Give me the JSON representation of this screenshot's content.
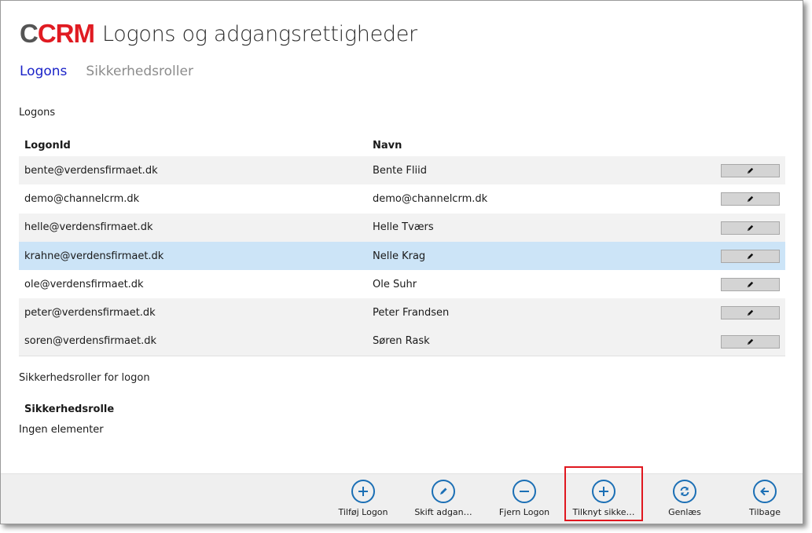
{
  "header": {
    "logo_c": "C",
    "logo_crm": "CRM",
    "title": "Logons og adgangsrettigheder"
  },
  "tabs": [
    {
      "label": "Logons",
      "active": true
    },
    {
      "label": "Sikkerhedsroller",
      "active": false
    }
  ],
  "logons_section": {
    "label": "Logons",
    "columns": {
      "logon_id": "LogonId",
      "navn": "Navn"
    },
    "rows": [
      {
        "logon_id": "bente@verdensfirmaet.dk",
        "navn": "Bente Fliid"
      },
      {
        "logon_id": "demo@channelcrm.dk",
        "navn": "demo@channelcrm.dk"
      },
      {
        "logon_id": "helle@verdensfirmaet.dk",
        "navn": "Helle Tværs"
      },
      {
        "logon_id": "krahne@verdensfirmaet.dk",
        "navn": "Nelle Krag",
        "selected": true
      },
      {
        "logon_id": "ole@verdensfirmaet.dk",
        "navn": "Ole Suhr"
      },
      {
        "logon_id": "peter@verdensfirmaet.dk",
        "navn": "Peter Frandsen"
      },
      {
        "logon_id": "soren@verdensfirmaet.dk",
        "navn": "Søren Rask"
      }
    ],
    "row_action_icon": "pencil-icon"
  },
  "roles_section": {
    "label": "Sikkerhedsroller for logon",
    "column": "Sikkerhedsrolle",
    "empty_text": "Ingen elementer"
  },
  "appbar": {
    "buttons": [
      {
        "label": "Tilføj Logon",
        "icon": "plus-icon"
      },
      {
        "label": "Skift adgan…",
        "icon": "pencil-icon"
      },
      {
        "label": "Fjern Logon",
        "icon": "minus-icon"
      },
      {
        "label": "Tilknyt sikke…",
        "icon": "plus-icon",
        "highlighted": true
      },
      {
        "label": "Genlæs",
        "icon": "refresh-icon"
      },
      {
        "label": "Tilbage",
        "icon": "back-arrow-icon"
      }
    ]
  },
  "colors": {
    "accent_blue": "#1b6fb5",
    "active_tab": "#1a22c8",
    "selected_row": "#cce4f7",
    "brand_red": "#e01b22",
    "highlight_border": "#e0171f"
  }
}
